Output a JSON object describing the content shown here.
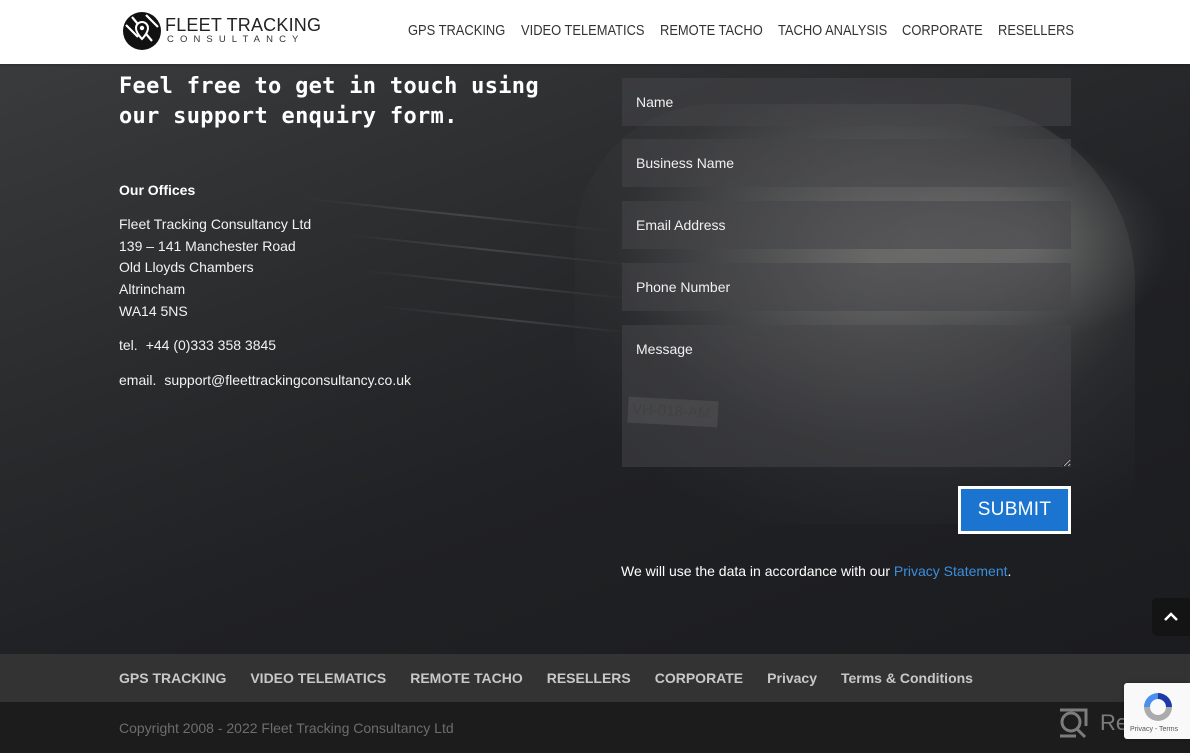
{
  "header": {
    "logo": {
      "line1": "FLEET TRACKING",
      "line2": "CONSULTANCY",
      "icon": "map-pin-globe-icon"
    },
    "nav": [
      {
        "label": "GPS TRACKING"
      },
      {
        "label": "VIDEO TELEMATICS"
      },
      {
        "label": "REMOTE TACHO"
      },
      {
        "label": "TACHO ANALYSIS"
      },
      {
        "label": "CORPORATE"
      },
      {
        "label": "RESELLERS"
      }
    ]
  },
  "contact": {
    "headline": "Feel free to get in touch using our support enquiry form.",
    "offices_title": "Our Offices",
    "address": [
      "Fleet Tracking Consultancy Ltd",
      "139 – 141 Manchester Road",
      "Old Lloyds Chambers",
      "Altrincham",
      "WA14 5NS"
    ],
    "tel_label": "tel.",
    "tel_value": "+44 (0)333 358 3845",
    "email_label": "email.",
    "email_value": "support@fleettrackingconsultancy.co.uk",
    "plate_text": "VH-018-AM"
  },
  "form": {
    "fields": {
      "name": {
        "placeholder": "Name",
        "value": ""
      },
      "business": {
        "placeholder": "Business Name",
        "value": ""
      },
      "email": {
        "placeholder": "Email Address",
        "value": ""
      },
      "phone": {
        "placeholder": "Phone Number",
        "value": ""
      },
      "message": {
        "placeholder": "Message",
        "value": ""
      }
    },
    "submit_label": "SUBMIT",
    "privacy_prefix": "We will use the data in accordance with our ",
    "privacy_link": "Privacy Statement",
    "privacy_suffix": ".",
    "accent_color": "#1a74d0"
  },
  "back_to_top": {
    "icon": "chevron-up-icon"
  },
  "footer": {
    "links": [
      {
        "label": "GPS TRACKING"
      },
      {
        "label": "VIDEO TELEMATICS"
      },
      {
        "label": "REMOTE TACHO"
      },
      {
        "label": "RESELLERS"
      },
      {
        "label": "CORPORATE"
      },
      {
        "label": "Privacy"
      },
      {
        "label": "Terms & Conditions"
      }
    ],
    "copyright": "Copyright 2008 - 2022 Fleet Tracking Consultancy Ltd"
  },
  "recaptcha": {
    "terms": "Privacy - Terms"
  },
  "watermark": {
    "text": "Revain"
  }
}
